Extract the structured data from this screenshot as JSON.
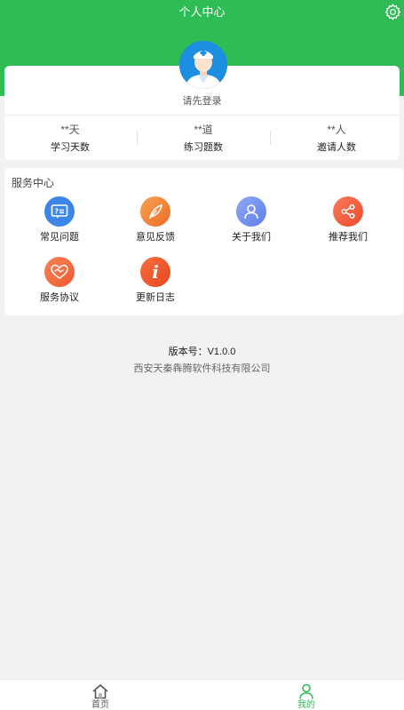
{
  "header": {
    "title": "个人中心"
  },
  "profile": {
    "login_prompt": "请先登录"
  },
  "stats": [
    {
      "value": "**天",
      "label": "学习天数"
    },
    {
      "value": "**道",
      "label": "练习题数"
    },
    {
      "value": "**人",
      "label": "邀请人数"
    }
  ],
  "services": {
    "title": "服务中心",
    "items": [
      {
        "label": "常见问题",
        "icon": "faq-icon",
        "color": "#3d86e6"
      },
      {
        "label": "意见反馈",
        "icon": "feather-icon",
        "color": "#f07a2b"
      },
      {
        "label": "关于我们",
        "icon": "user-icon",
        "color": "#6d8cf0"
      },
      {
        "label": "推荐我们",
        "icon": "share-icon",
        "color": "#f15a3e"
      },
      {
        "label": "服务协议",
        "icon": "handshake-icon",
        "color": "#f2653a"
      },
      {
        "label": "更新日志",
        "icon": "info-icon",
        "color": "#ef5a2e"
      }
    ]
  },
  "footer": {
    "version": "版本号：V1.0.0",
    "company": "西安天秦犇腾软件科技有限公司"
  },
  "tabbar": {
    "items": [
      {
        "label": "首页",
        "active": false
      },
      {
        "label": "我的",
        "active": true
      }
    ],
    "active_color": "#2fbc55",
    "inactive_color": "#555555"
  },
  "colors": {
    "brand": "#2fbc55",
    "background": "#f1f2f4"
  }
}
